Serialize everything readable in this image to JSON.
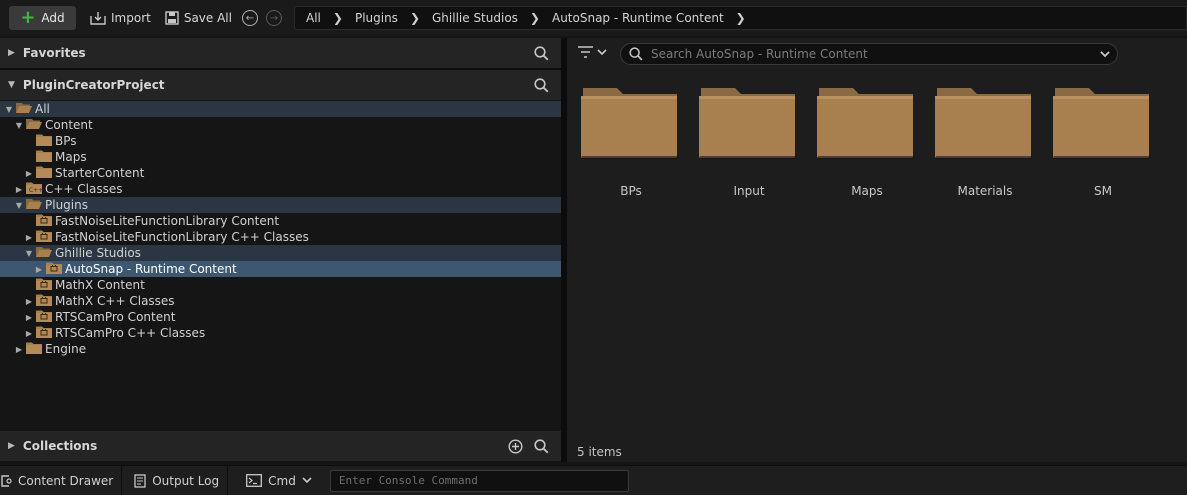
{
  "toolbar": {
    "add_label": "Add",
    "import_label": "Import",
    "save_all_label": "Save All",
    "breadcrumb": [
      "All",
      "Plugins",
      "Ghillie Studios",
      "AutoSnap - Runtime Content"
    ]
  },
  "left": {
    "favorites_label": "Favorites",
    "project_label": "PluginCreatorProject",
    "collections_label": "Collections",
    "tree": [
      {
        "label": "All",
        "depth": 0,
        "arrow": "down",
        "icon": "folder-open-icon",
        "state": "highlight"
      },
      {
        "label": "Content",
        "depth": 1,
        "arrow": "down",
        "icon": "folder-open-icon",
        "state": ""
      },
      {
        "label": "BPs",
        "depth": 2,
        "arrow": "",
        "icon": "folder-icon",
        "state": ""
      },
      {
        "label": "Maps",
        "depth": 2,
        "arrow": "",
        "icon": "folder-icon",
        "state": ""
      },
      {
        "label": "StarterContent",
        "depth": 2,
        "arrow": "right",
        "icon": "folder-icon",
        "state": ""
      },
      {
        "label": "C++ Classes",
        "depth": 1,
        "arrow": "right",
        "icon": "cpp-folder-icon",
        "state": ""
      },
      {
        "label": "Plugins",
        "depth": 1,
        "arrow": "down",
        "icon": "folder-open-icon",
        "state": "highlight"
      },
      {
        "label": "FastNoiseLiteFunctionLibrary Content",
        "depth": 2,
        "arrow": "",
        "icon": "plugin-folder-icon",
        "state": ""
      },
      {
        "label": "FastNoiseLiteFunctionLibrary C++ Classes",
        "depth": 2,
        "arrow": "right",
        "icon": "plugin-folder-icon",
        "state": ""
      },
      {
        "label": "Ghillie Studios",
        "depth": 2,
        "arrow": "down",
        "icon": "folder-open-icon",
        "state": "highlight"
      },
      {
        "label": "AutoSnap - Runtime Content",
        "depth": 3,
        "arrow": "right",
        "icon": "plugin-folder-icon",
        "state": "selected"
      },
      {
        "label": "MathX Content",
        "depth": 2,
        "arrow": "",
        "icon": "plugin-folder-icon",
        "state": ""
      },
      {
        "label": "MathX C++ Classes",
        "depth": 2,
        "arrow": "right",
        "icon": "plugin-folder-icon",
        "state": ""
      },
      {
        "label": "RTSCamPro Content",
        "depth": 2,
        "arrow": "right",
        "icon": "plugin-folder-icon",
        "state": ""
      },
      {
        "label": "RTSCamPro C++ Classes",
        "depth": 2,
        "arrow": "right",
        "icon": "plugin-folder-icon",
        "state": ""
      },
      {
        "label": "Engine",
        "depth": 1,
        "arrow": "right",
        "icon": "folder-icon",
        "state": ""
      }
    ]
  },
  "right": {
    "search_placeholder": "Search AutoSnap - Runtime Content",
    "folders": [
      "BPs",
      "Input",
      "Maps",
      "Materials",
      "SM"
    ],
    "items_count": "5 items"
  },
  "bottom": {
    "content_drawer_label": "Content Drawer",
    "output_log_label": "Output Log",
    "cmd_label": "Cmd",
    "console_placeholder": "Enter Console Command"
  },
  "colors": {
    "folder": "#a87f4f",
    "selected_row": "#3e5770",
    "highlight_row": "#2a3644",
    "add_plus": "#3fb945"
  }
}
